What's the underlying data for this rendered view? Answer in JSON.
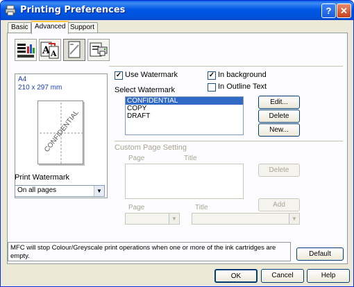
{
  "window": {
    "title": "Printing Preferences",
    "help_glyph": "?",
    "close_glyph": "✕"
  },
  "tabs": [
    {
      "label": "Basic",
      "active": false
    },
    {
      "label": "Advanced",
      "active": true
    },
    {
      "label": "Support",
      "active": false
    }
  ],
  "toolbar": {
    "icons": [
      "print-quality-icon",
      "scaling-icon",
      "watermark-icon",
      "device-options-icon"
    ],
    "selected": "watermark-icon"
  },
  "preview": {
    "paper_size": "A4",
    "dimensions": "210 x 297 mm",
    "watermark_text": "CONFIDENTIAL"
  },
  "print_watermark": {
    "label": "Print Watermark",
    "value": "On all pages"
  },
  "watermark": {
    "use_watermark_label": "Use Watermark",
    "use_watermark_checked": "✓",
    "in_background_label": "In background",
    "in_background_checked": "✓",
    "in_outline_text_label": "In Outline Text",
    "select_label": "Select Watermark",
    "items": [
      "CONFIDENTIAL",
      "COPY",
      "DRAFT"
    ],
    "selected_index": 0,
    "edit_button": "Edit...",
    "delete_button": "Delete",
    "new_button": "New..."
  },
  "custom_page": {
    "section_label": "Custom Page Setting",
    "page_col": "Page",
    "title_col": "Title",
    "delete_button": "Delete",
    "add_button": "Add",
    "page_label": "Page",
    "title_label": "Title"
  },
  "status_message": "MFC will stop Colour/Greyscale print operations when one or more of the ink cartridges are empty.",
  "buttons": {
    "default": "Default",
    "ok": "OK",
    "cancel": "Cancel",
    "help": "Help"
  }
}
